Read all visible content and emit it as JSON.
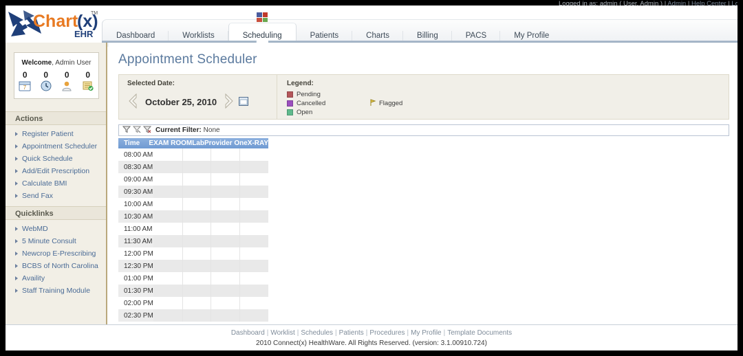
{
  "topbar": {
    "logged_in_text": "Logged in as: admin ( User, Admin )",
    "sep": "|",
    "admin_link": "Admin",
    "help_link": "Help Center",
    "logout_link": "Lo"
  },
  "logo": {
    "word1": "Chart",
    "word2": "(x)",
    "tm": "TM",
    "sub": "EHR"
  },
  "tabs": [
    {
      "label": "Dashboard",
      "active": false
    },
    {
      "label": "Worklists",
      "active": false
    },
    {
      "label": "Scheduling",
      "active": true
    },
    {
      "label": "Patients",
      "active": false
    },
    {
      "label": "Charts",
      "active": false
    },
    {
      "label": "Billing",
      "active": false
    },
    {
      "label": "PACS",
      "active": false
    },
    {
      "label": "My Profile",
      "active": false
    }
  ],
  "sidebar": {
    "welcome_prefix": "Welcome",
    "welcome_name": ", Admin User",
    "counters": [
      "0",
      "0",
      "0",
      "0"
    ],
    "counter_icons": [
      "calendar-icon",
      "clock-icon",
      "patient-icon",
      "notes-check-icon"
    ],
    "actions_title": "Actions",
    "actions": [
      "Register Patient",
      "Appointment Scheduler",
      "Quick Schedule",
      "Add/Edit Prescription",
      "Calculate BMI",
      "Send Fax"
    ],
    "quicklinks_title": "Quicklinks",
    "quicklinks": [
      "WebMD",
      "5 Minute Consult",
      "Newcrop E-Prescribing",
      "BCBS of North Carolina",
      "Availity",
      "Staff Training Module"
    ]
  },
  "main": {
    "page_title": "Appointment Scheduler",
    "selected_date_label": "Selected Date:",
    "selected_date": "October 25, 2010",
    "legend_label": "Legend:",
    "legend": [
      {
        "label": "Pending",
        "color": "#b4565a"
      },
      {
        "label": "Cancelled",
        "color": "#9b4fbe"
      },
      {
        "label": "Open",
        "color": "#5fba8d"
      }
    ],
    "flagged_label": "Flagged",
    "filter_label": "Current Filter:",
    "filter_value": "None",
    "columns": [
      "Time",
      "EXAM ROOM",
      "Lab",
      "Provider One",
      "X-RAY"
    ],
    "rows": [
      "08:00 AM",
      "08:30 AM",
      "09:00 AM",
      "09:30 AM",
      "10:00 AM",
      "10:30 AM",
      "11:00 AM",
      "11:30 AM",
      "12:00 PM",
      "12:30 PM",
      "01:00 PM",
      "01:30 PM",
      "02:00 PM",
      "02:30 PM"
    ]
  },
  "footer": {
    "links": [
      "Dashboard",
      "Worklist",
      "Schedules",
      "Patients",
      "Procedures",
      "My Profile",
      "Template Documents"
    ],
    "copyright": "2010 Connect(x) HealthWare. All Rights Reserved. (version: 3.1.00910.724)"
  }
}
